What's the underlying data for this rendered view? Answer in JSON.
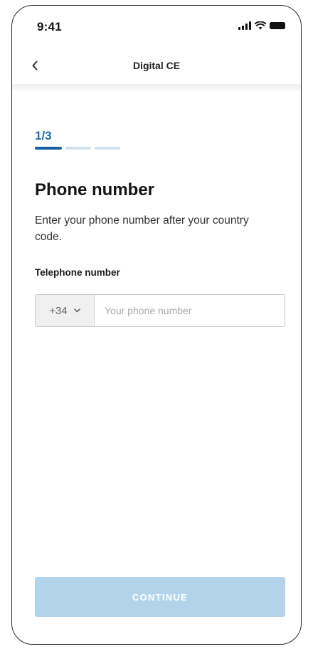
{
  "status_bar": {
    "time": "9:41",
    "icons": [
      "signal-icon",
      "wifi-icon",
      "battery-icon"
    ]
  },
  "nav": {
    "back_icon": "chevron-left-icon",
    "title": "Digital CE"
  },
  "stepper": {
    "label": "1/3",
    "current_step": 1,
    "total_steps": 3
  },
  "page": {
    "title": "Phone number",
    "description": "Enter your phone number after your country code."
  },
  "form": {
    "phone_label": "Telephone number",
    "country_code": "+34",
    "country_code_icon": "chevron-down-icon",
    "phone_value": "",
    "phone_placeholder": "Your phone number"
  },
  "actions": {
    "continue_label": "CONTINUE",
    "continue_enabled": false
  },
  "colors": {
    "accent": "#1560a0",
    "progress_pending": "#cfe0ef",
    "button_disabled": "#b3d3ea"
  }
}
